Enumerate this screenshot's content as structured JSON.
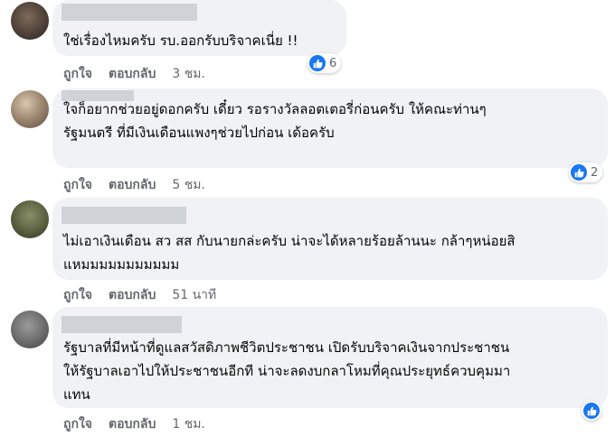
{
  "comments": [
    {
      "text_lines": [
        "ใช่เรื่องไหมครับ รบ.ออกรับบริจาคเนี่ย !!"
      ],
      "actions": {
        "like": "ถูกใจ",
        "reply": "ตอบกลับ",
        "time": "3 ชม."
      },
      "reactions": "6"
    },
    {
      "text_lines": [
        "ใจก็อยากช่วยอยู่ดอกครับ เดี๋ยว รอรางวัลลอตเตอรี่ก่อนครับ ให้คณะท่านๆ",
        "รัฐมนตรี ที่มีเงินเดือนแพงๆช่วยไปก่อน เด้อครับ"
      ],
      "actions": {
        "like": "ถูกใจ",
        "reply": "ตอบกลับ",
        "time": "5 ชม."
      },
      "reactions": "2"
    },
    {
      "text_lines": [
        "ไม่เอาเงินเดือน สว สส กับนายกล่ะครับ น่าจะได้หลายร้อยล้านนะ กล้าๆหน่อยสิ",
        "แหมมมมมมมมมมม"
      ],
      "actions": {
        "like": "ถูกใจ",
        "reply": "ตอบกลับ",
        "time": "51 นาที"
      }
    },
    {
      "text_lines": [
        "รัฐบาลที่มีหน้าที่ดูแลสวัสดิภาพชีวิตประชาชน เปิดรับบริจาคเงินจากประชาชน",
        "ให้รัฐบาลเอาไปให้ประชาชนอีกที น่าจะลดงบกลาโหมที่คุณประยุทธ์ควบคุมมา",
        "แทน"
      ],
      "actions": {
        "like": "ถูกใจ",
        "reply": "ตอบกลับ",
        "time": "1 ชม."
      }
    }
  ],
  "colors": {
    "bubble": "#f0f2f5",
    "like_blue": "#1877f2",
    "secondary_text": "#65676b"
  },
  "icons": {
    "reaction": "like-icon"
  }
}
